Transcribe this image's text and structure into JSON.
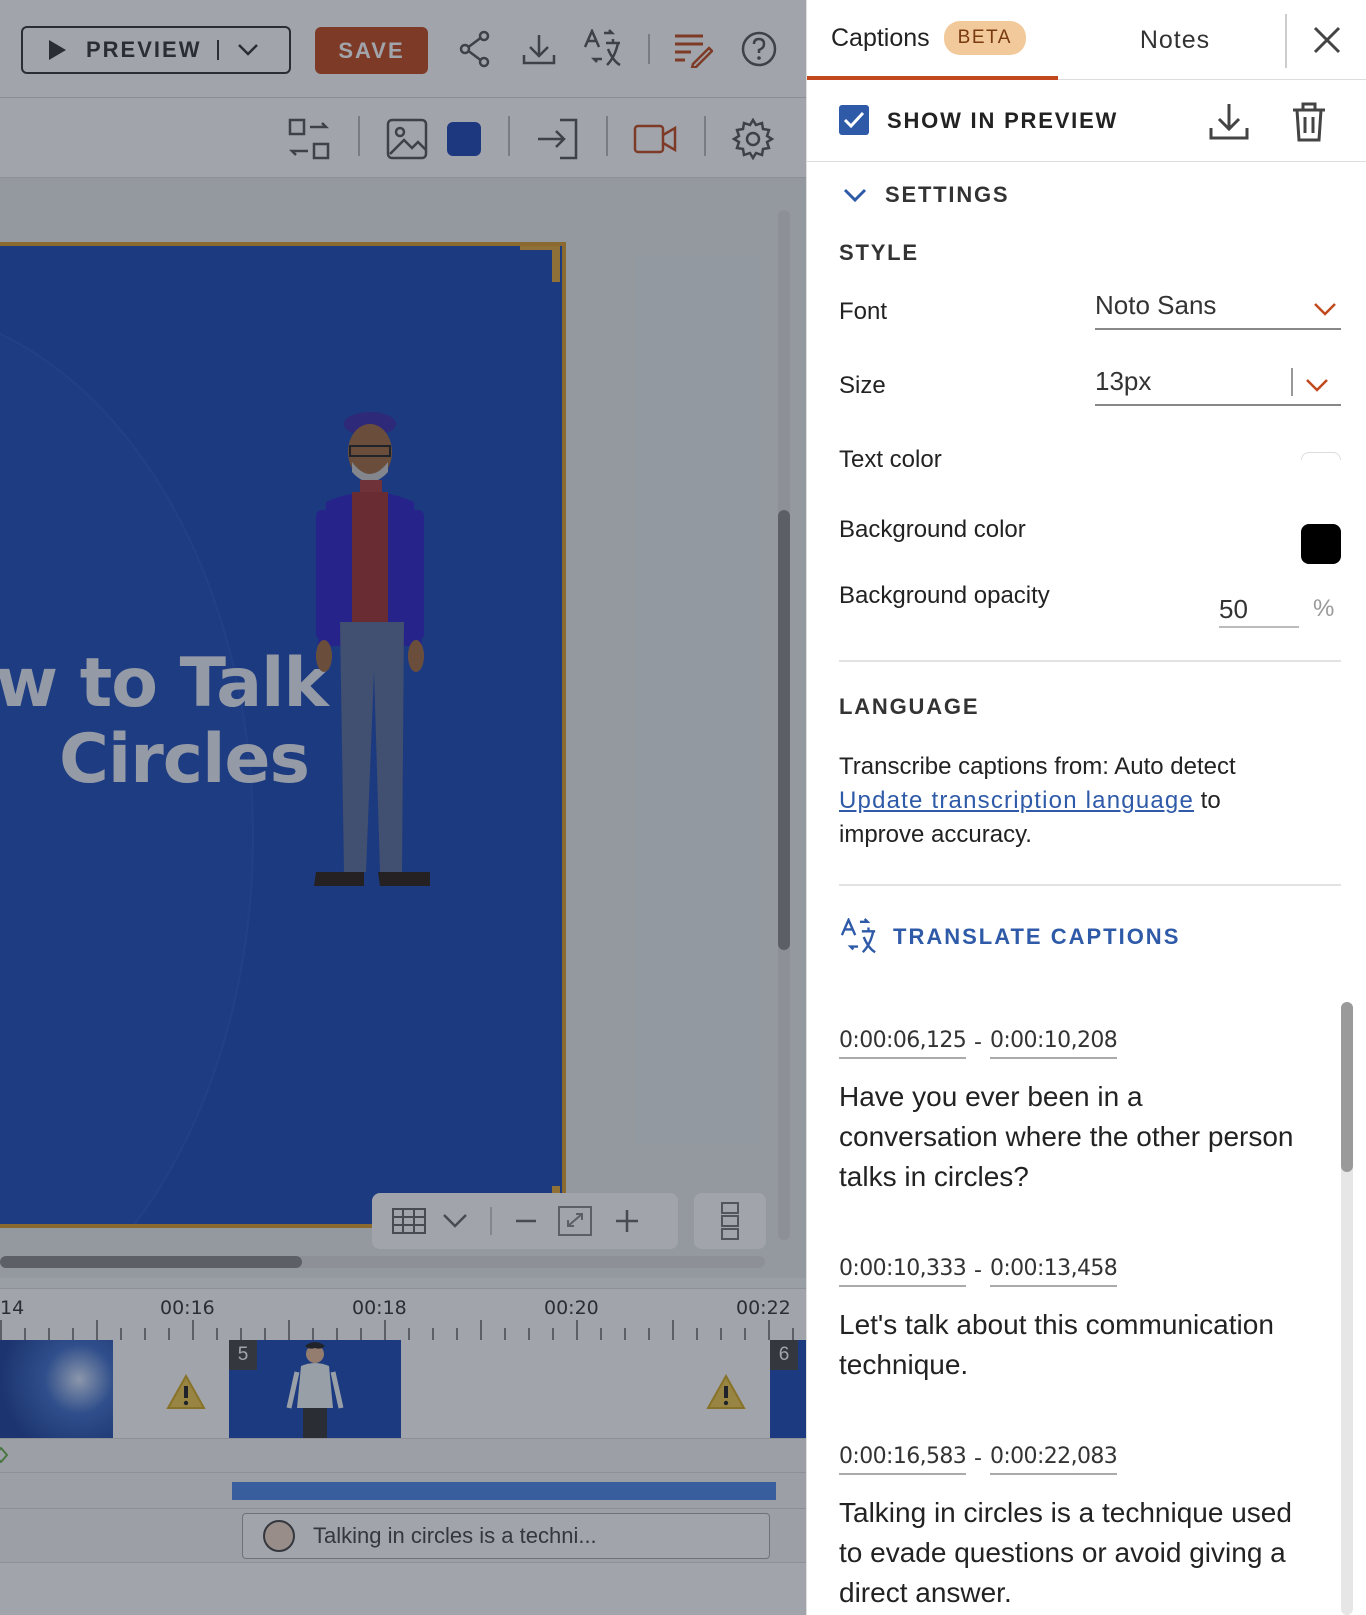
{
  "toolbar": {
    "preview_label": "PREVIEW",
    "save_label": "SAVE",
    "accent_color": "#c1491d"
  },
  "slide": {
    "title_line1": "w to Talk i",
    "title_line2": "Circles",
    "background_color": "#1b47b3"
  },
  "timeline": {
    "ruler_labels": [
      "14",
      "00:16",
      "00:18",
      "00:20",
      "00:22"
    ],
    "scenes": [
      {
        "number": "5"
      },
      {
        "number": "6"
      }
    ],
    "audio_clip_text": "Talking in circles is a techni..."
  },
  "panel": {
    "tabs": {
      "captions_label": "Captions",
      "beta_badge": "BETA",
      "notes_label": "Notes"
    },
    "show_in_preview": {
      "label": "SHOW IN PREVIEW",
      "checked": true
    },
    "settings": {
      "header": "SETTINGS",
      "style_label": "STYLE",
      "font_label": "Font",
      "font_value": "Noto Sans",
      "size_label": "Size",
      "size_value": "13px",
      "text_color_label": "Text color",
      "text_color": "#ffffff",
      "bg_color_label": "Background color",
      "bg_color": "#000000",
      "bg_opacity_label": "Background opacity",
      "bg_opacity_value": "50",
      "bg_opacity_unit": "%",
      "language_label": "LANGUAGE",
      "transcribe_text": "Transcribe captions from: Auto detect",
      "update_link": "Update transcription language",
      "update_suffix": " to improve accuracy.",
      "translate_label": "TRANSLATE CAPTIONS"
    },
    "captions": [
      {
        "start": "0:00:06,125",
        "end": "0:00:10,208",
        "text": "Have you ever been in a conversation where the other person talks in circles?"
      },
      {
        "start": "0:00:10,333",
        "end": "0:00:13,458",
        "text": "Let's talk about this communication technique."
      },
      {
        "start": "0:00:16,583",
        "end": "0:00:22,083",
        "text": "Talking in circles is a technique used to evade questions or avoid giving a direct answer."
      }
    ]
  }
}
